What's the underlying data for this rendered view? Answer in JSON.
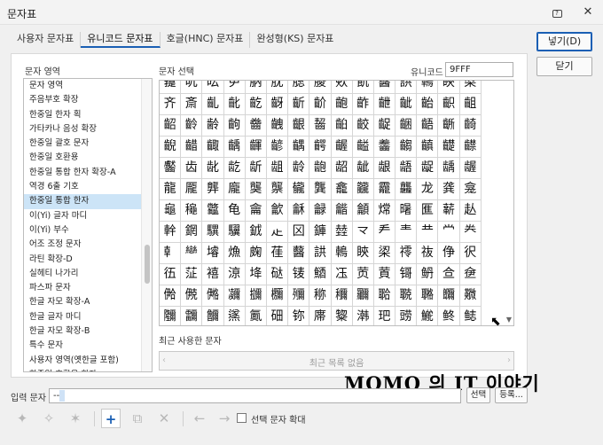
{
  "window": {
    "title": "문자표",
    "help_icon": "help-icon",
    "close_glyph": "✕"
  },
  "tabs": [
    {
      "label": "사용자 문자표"
    },
    {
      "label": "유니코드 문자표",
      "active": true
    },
    {
      "label": "호글(HNC) 문자표"
    },
    {
      "label": "완성형(KS) 문자표"
    }
  ],
  "buttons": {
    "insert": "넣기(D)",
    "close": "닫기",
    "select": "선택",
    "register": "등록..."
  },
  "area": {
    "label": "문자 영역",
    "items": [
      "문자 영역 ",
      "주음부호 확장",
      "한중일 한자 획",
      "가타카나 음성 확장",
      "한중일 괄호 문자",
      "한중일 호환용",
      "한중일 통합 한자 확장-A",
      "역경 6출 기호",
      "한중일 통합 한자",
      "이(Yi) 글자 마디",
      "이(Yi) 부수",
      "어조 조정 문자",
      "라틴 확장-D",
      "실헤티 나가리",
      "파스파 문자",
      "한글 자모 확장-A",
      "한글 글자 마디",
      "한글 자모 확장-B",
      "특수 문자",
      "사용자 영역(옛한글 포함)",
      "한중일 호환용 한자"
    ],
    "selected_index": 8
  },
  "char_select": {
    "label": "문자 선택",
    "unicode_label": "유니코드",
    "unicode_value": "9FFF",
    "rows": [
      "䶶䶷䶸䶹䶺䶻䶼䶽䶾䶿鿀鿁鿂鿃鿄",
      "齐斎齓齔齕齖齗齘齙齚齛齜齝齞齟",
      "齠齡齢齣齤齥齦齧齨齩齪齫齬齭齮",
      "齯齰齱齲齳齴齵齶齷齸齹齺齻齼齽",
      "齾齿龀龁龂龃龄龅龆龇龈龉龊龋龌",
      "龍龎龏龐龑龒龓龔龕龖龗龘龙龚龛",
      "龜龝龞龟龠龡龢龣龤龥龦龧龨龩龪",
      "龫龬龭龮龯龰龱龲龳龴龵龶龷龸龹",
      "龺龻龼龽龾龿鿀鿁鿂鿃鿄鿅鿆鿇鿈",
      "鿉鿊鿋鿌鿍鿎鿏鿐鿑鿒鿓鿔鿕鿖鿗",
      "鿘鿙鿚鿛鿜鿝鿞鿟鿠鿡鿢鿣鿤鿥鿦",
      "鿧鿨鿩鿪鿫鿬鿭鿮鿯鿰鿱鿲鿳鿴鿵",
      "鿶鿷鿸鿹鿺鿻鿼鿽鿾鿿鿐鿑鿒鿓鿿"
    ],
    "selected_char": "鿿"
  },
  "recent": {
    "label": "최근 사용한 문자",
    "empty_text": "최근 목록 없음"
  },
  "input": {
    "label": "입력 문자",
    "value": "--"
  },
  "toolbar": {
    "add_icon": "add-icon",
    "checkbox_label": "선택 문자 확대"
  },
  "watermark": "MOMO 의 IT 이야기",
  "colors": {
    "accent": "#1a5fb4",
    "selected_cell": "#2f6fd6",
    "highlight_box": "#e31b1b",
    "selected_item": "#cce4f7"
  }
}
